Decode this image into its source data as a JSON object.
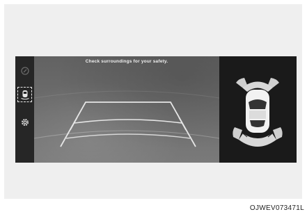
{
  "screen": {
    "warning_text": "Check surroundings for your safety.",
    "sidebar": {
      "items": [
        {
          "icon": "rear-camera-icon",
          "selected": false
        },
        {
          "icon": "parking-view-icon",
          "selected": true
        },
        {
          "icon": "settings-gear-icon",
          "selected": false
        }
      ]
    },
    "colors": {
      "screen_bg": "#1c1c1c",
      "camera_bg": "#6a6a6a",
      "guide_line": "#e6e6e6",
      "sensor_zone": "#d8d8d8"
    }
  },
  "figure_code": "OJWEV073471L"
}
